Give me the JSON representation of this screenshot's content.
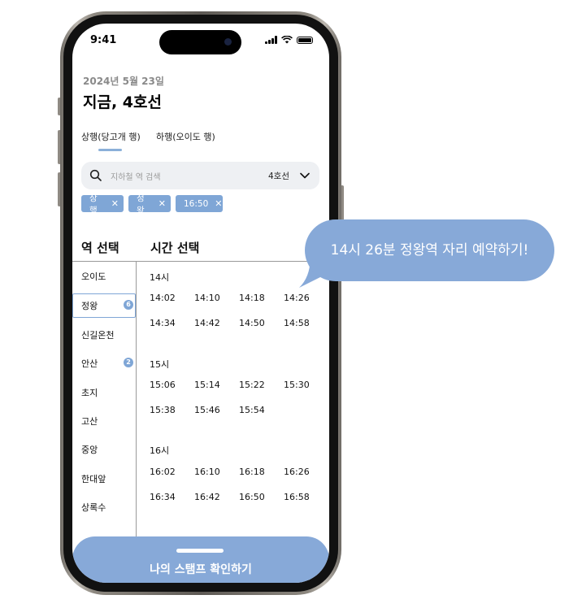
{
  "status": {
    "time": "9:41"
  },
  "header": {
    "date": "2024년 5월 23일",
    "title": "지금, 4호선"
  },
  "tabs": [
    {
      "label": "상행(당고개 행)"
    },
    {
      "label": "하행(오이도 행)"
    }
  ],
  "search": {
    "placeholder": "지하철 역 검색",
    "line": "4호선"
  },
  "chips": [
    {
      "label": "상행"
    },
    {
      "label": "정왕"
    },
    {
      "label": "16:50"
    }
  ],
  "sections": {
    "station": "역 선택",
    "time": "시간 선택"
  },
  "stations": [
    {
      "name": "오이도"
    },
    {
      "name": "정왕",
      "badge": "6"
    },
    {
      "name": "신길온천"
    },
    {
      "name": "안산",
      "badge": "2"
    },
    {
      "name": "초지"
    },
    {
      "name": "고산"
    },
    {
      "name": "중앙"
    },
    {
      "name": "한대앞"
    },
    {
      "name": "상록수"
    }
  ],
  "hours": [
    {
      "label": "14시",
      "times": [
        "14:02",
        "14:10",
        "14:18",
        "14:26",
        "14:34",
        "14:42",
        "14:50",
        "14:58"
      ]
    },
    {
      "label": "15시",
      "times": [
        "15:06",
        "15:14",
        "15:22",
        "15:30",
        "15:38",
        "15:46",
        "15:54"
      ]
    },
    {
      "label": "16시",
      "times": [
        "16:02",
        "16:10",
        "16:18",
        "16:26",
        "16:34",
        "16:42",
        "16:50",
        "16:58"
      ]
    }
  ],
  "bottom": {
    "label": "나의 스탬프 확인하기"
  },
  "bubble": {
    "text": "14시 26분 정왕역 자리 예약하기!"
  },
  "colors": {
    "accent": "#87a9d8",
    "chip": "#7fa6d6"
  }
}
